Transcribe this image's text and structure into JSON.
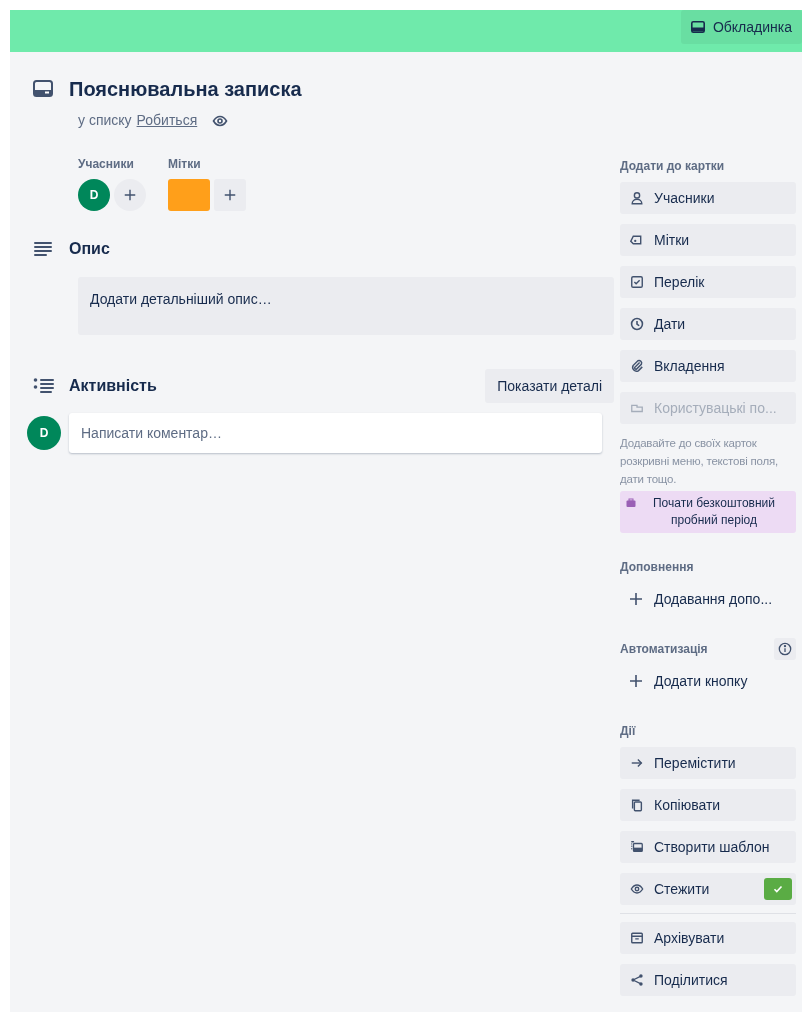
{
  "cover": {
    "color": "#6feaab",
    "button": "Обкладинка"
  },
  "card": {
    "title": "Пояснювальна записка",
    "list_prefix": "у списку",
    "list_name": "Робиться",
    "watching": true
  },
  "members": {
    "label": "Учасники",
    "avatars": [
      {
        "initial": "D",
        "color": "#00875a"
      }
    ]
  },
  "labels": {
    "label": "Мітки",
    "items": [
      {
        "color": "#ff9f1a"
      }
    ]
  },
  "description": {
    "heading": "Опис",
    "placeholder": "Додати детальніший опис…"
  },
  "activity": {
    "heading": "Активність",
    "button": "Показати деталі",
    "avatar": {
      "initial": "D",
      "color": "#00875a"
    },
    "comment_placeholder": "Написати коментар…"
  },
  "sidebar": [
    {
      "title": "Додати до картки",
      "items": [
        {
          "kind": "user",
          "label": "Учасники",
          "disabled": false
        },
        {
          "kind": "tag",
          "label": "Мітки",
          "disabled": false
        },
        {
          "kind": "checklist",
          "label": "Перелік",
          "disabled": false
        },
        {
          "kind": "clock",
          "label": "Дати",
          "disabled": false
        },
        {
          "kind": "paperclip",
          "label": "Вкладення",
          "disabled": false
        },
        {
          "kind": "field",
          "label": "Користувацькі по...",
          "disabled": true
        }
      ],
      "note": "Додавайте до своїх карток розкривні меню, текстові поля, дати тощо.",
      "promo": "Почати безкоштовний пробний період"
    },
    {
      "title": "Доповнення",
      "items": [
        {
          "kind": "plus",
          "label": "Додавання допо..."
        }
      ]
    },
    {
      "title": "Автоматизація",
      "info": true,
      "items": [
        {
          "kind": "plus",
          "label": "Додати кнопку"
        }
      ]
    },
    {
      "title": "Дії",
      "items": [
        {
          "kind": "arrow",
          "label": "Перемістити",
          "checked": false
        },
        {
          "kind": "copy",
          "label": "Копіювати",
          "checked": false
        },
        {
          "kind": "template",
          "label": "Створити шаблон",
          "checked": false
        },
        {
          "kind": "eye",
          "label": "Стежити",
          "checked": true
        }
      ],
      "more_items": [
        {
          "kind": "archive",
          "label": "Архівувати"
        },
        {
          "kind": "share",
          "label": "Поділитися"
        }
      ]
    }
  ]
}
